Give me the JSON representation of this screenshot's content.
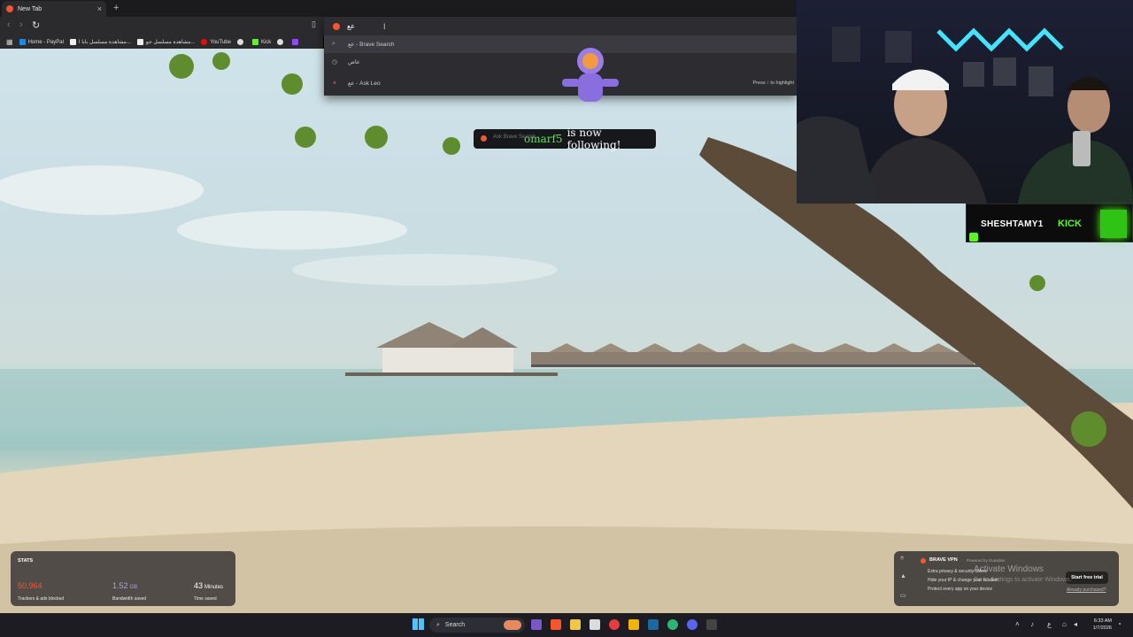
{
  "browser": {
    "tab_title": "New Tab",
    "new_tab_symbol": "+",
    "close_symbol": "×",
    "address_value": "عع",
    "bookmarks": [
      {
        "label": "Home - PayPal",
        "color": "#1e88e5"
      },
      {
        "label": "مشاهدة مسلسل بابا ا...",
        "color": "#eeeeee"
      },
      {
        "label": "مشاهدة مسلسل جو...",
        "color": "#eeeeee"
      },
      {
        "label": "YouTube",
        "color": "#ff0000"
      },
      {
        "label": "",
        "color": "#dddddd"
      },
      {
        "label": "Kick",
        "color": "#53fc18"
      }
    ]
  },
  "omnibox": {
    "suggestions": [
      {
        "text": "عع - Brave Search",
        "icon": "search-icon"
      },
      {
        "text": "عاص",
        "icon": "history-icon"
      },
      {
        "text": "عع - Ask Leo",
        "icon": "leo-icon"
      }
    ],
    "hint": "Press ↑ to highlight"
  },
  "notification": {
    "username": "omarf5",
    "message": "is now following!",
    "ghost_text": "Ask Brave Search"
  },
  "stream": {
    "channel": "SHESHTAMY1",
    "platform": "KICK"
  },
  "stats": {
    "heading": "STATS",
    "trackers_value": "50,964",
    "trackers_label": "Trackers & ads blocked",
    "bandwidth_value": "1.52",
    "bandwidth_unit": "GB",
    "bandwidth_label": "Bandwidth saved",
    "time_value": "43",
    "time_unit": "Minutes",
    "time_label": "Time saved"
  },
  "vpn": {
    "title": "BRAVE VPN",
    "powered": "Powered by Guardian",
    "features": [
      "Extra privacy & security online",
      "Hide your IP & change your location",
      "Protect every app on your device"
    ],
    "trial_button": "Start free trial",
    "already": "Already purchased?"
  },
  "watermark": {
    "line1": "Activate Windows",
    "line2": "Go to Settings to activate Windows."
  },
  "taskbar": {
    "search_label": "Search",
    "time": "6:33 AM",
    "date": "1/7/2026"
  },
  "colors": {
    "stats_trackers": "#fb542b",
    "stats_bandwidth": "#a0a5eb",
    "kick_green": "#53fc18",
    "follow_name": "#56e84a"
  }
}
